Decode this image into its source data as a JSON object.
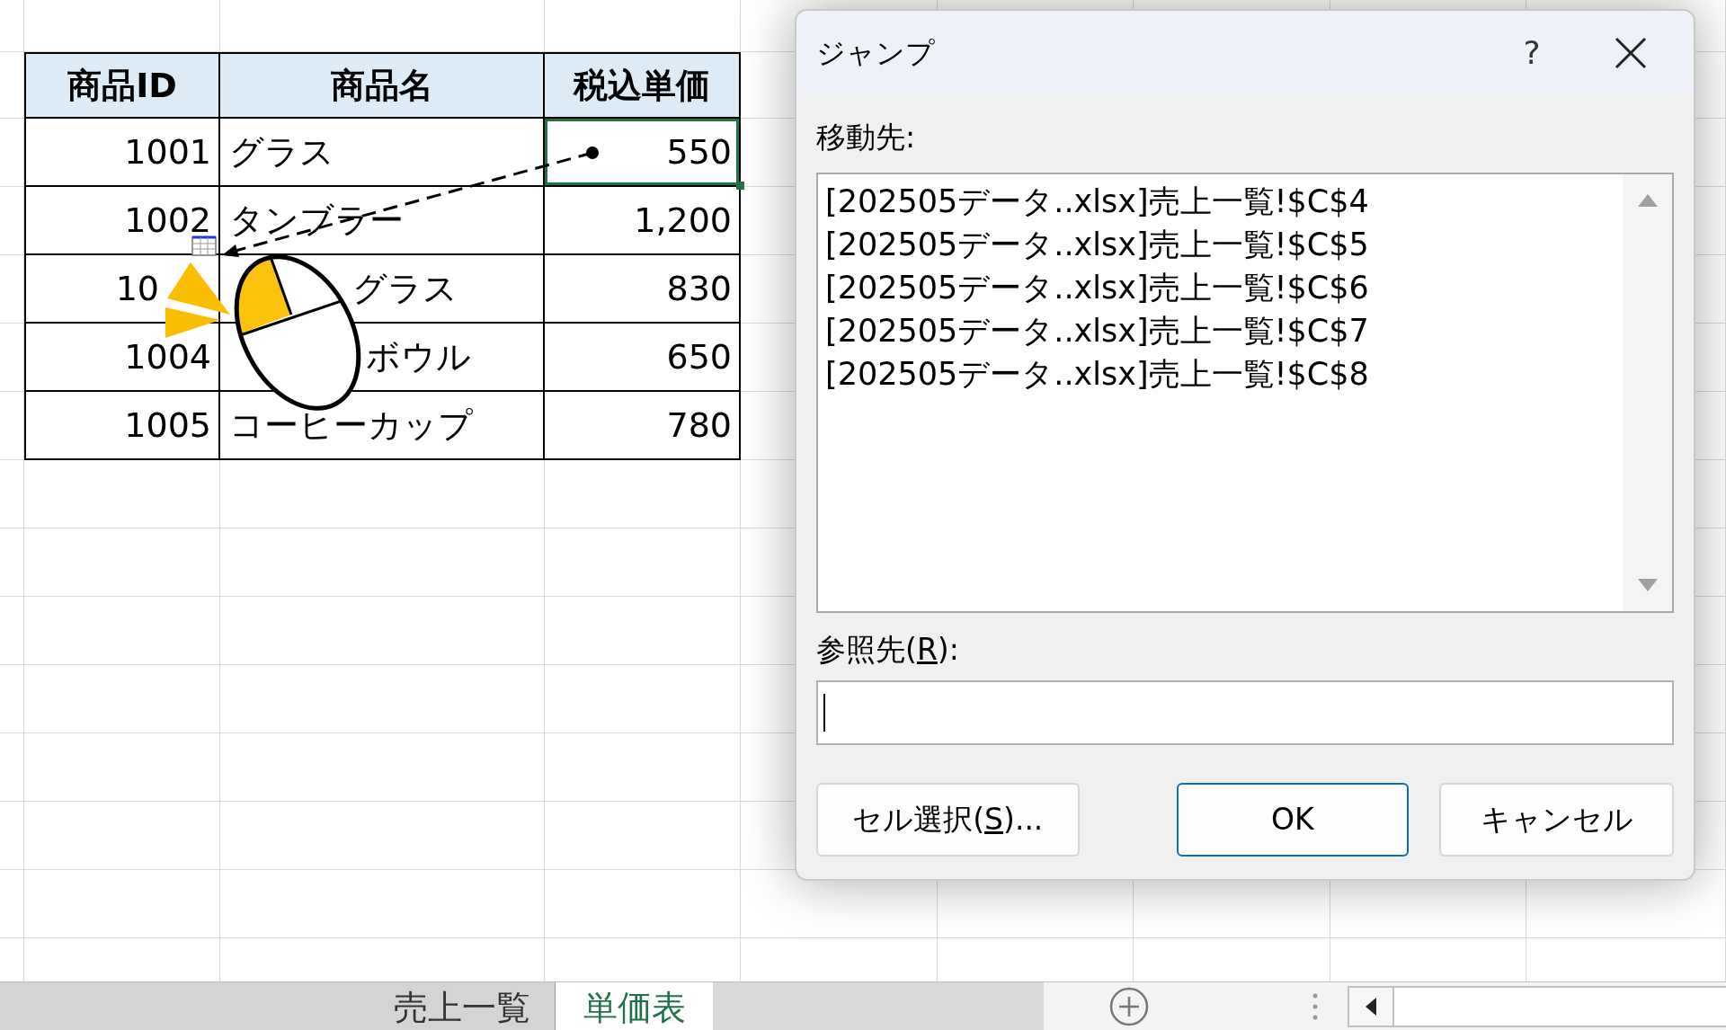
{
  "sheet": {
    "columns": [
      "商品ID",
      "商品名",
      "税込単価"
    ],
    "rows": [
      {
        "id": "1001",
        "name": "グラス",
        "price": "550",
        "selected": true
      },
      {
        "id": "1002",
        "name": "タンブラー",
        "price": "1,200",
        "selected": false
      },
      {
        "id": "10",
        "name": "グラス",
        "price": "830",
        "selected": false
      },
      {
        "id": "1004",
        "name": "ボウル",
        "price": "650",
        "selected": false
      },
      {
        "id": "1005",
        "name": "コーヒーカップ",
        "price": "780",
        "selected": false
      }
    ]
  },
  "dialog": {
    "title": "ジャンプ",
    "help": "?",
    "goto_label": "移動先:",
    "goto_items": [
      "[202505データ..xlsx]売上一覧!$C$4",
      "[202505データ..xlsx]売上一覧!$C$5",
      "[202505データ..xlsx]売上一覧!$C$6",
      "[202505データ..xlsx]売上一覧!$C$7",
      "[202505データ..xlsx]売上一覧!$C$8"
    ],
    "reference_label": {
      "before": "参照先(",
      "key": "R",
      "after": "):"
    },
    "buttons": [
      {
        "kind": "normal",
        "before": "セル選択(",
        "key": "S",
        "after": ")..."
      },
      {
        "kind": "default",
        "before": "OK"
      },
      {
        "kind": "normal",
        "before": "キャンセル"
      }
    ]
  },
  "sheet_tabs": [
    {
      "label": "売上一覧",
      "selected": false
    },
    {
      "label": "単価表",
      "selected": true
    }
  ]
}
